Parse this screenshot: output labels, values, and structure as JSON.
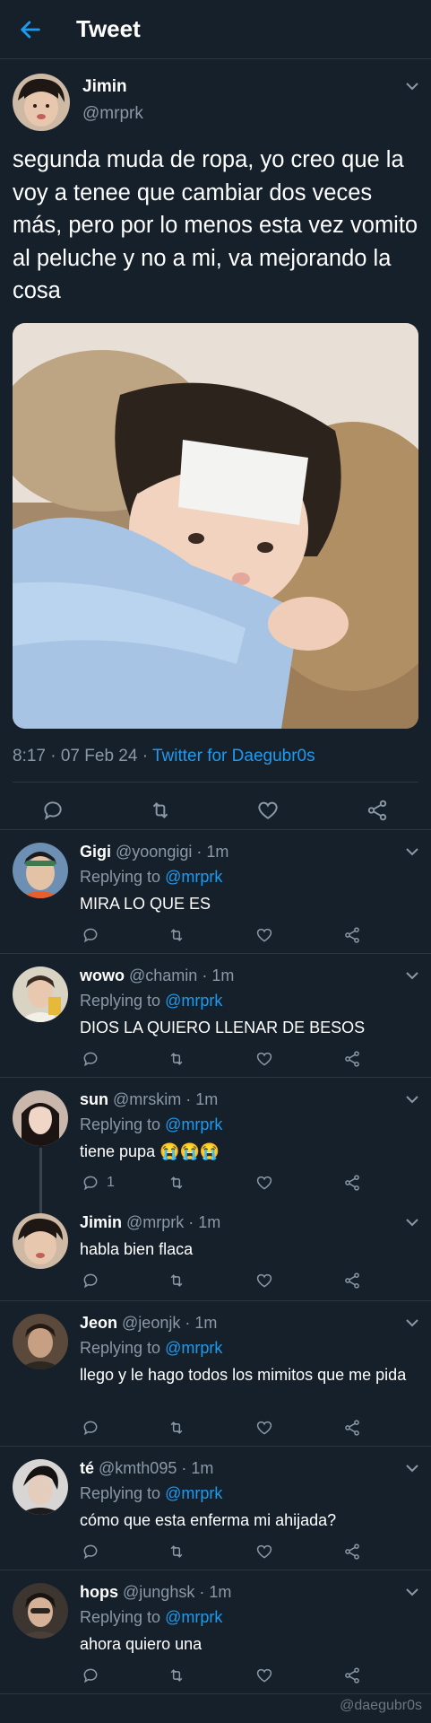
{
  "header": {
    "title": "Tweet",
    "back_icon": "arrow-left-icon"
  },
  "main_tweet": {
    "author_name": "Jimin",
    "author_handle": "@mrprk",
    "text": "segunda muda de ropa, yo creo que la voy a tenee que cambiar dos veces más, pero por lo menos esta vez vomito al peluche y no a mi, va mejorando la cosa",
    "timestamp": "8:17 · 07 Feb 24 · ",
    "source": "Twitter for Daegubr0s",
    "actions": [
      "reply-icon",
      "retweet-icon",
      "like-icon",
      "share-icon"
    ]
  },
  "replies": [
    {
      "name": "Gigi",
      "handle": "@yoongigi",
      "time": " · 1m",
      "replying_label": "Replying to ",
      "mention": "@mrprk",
      "text": "MIRA LO QUE ES",
      "reply_count": ""
    },
    {
      "name": "wowo",
      "handle": "@chamin",
      "time": " · 1m",
      "replying_label": "Replying to ",
      "mention": "@mrprk",
      "text": "DIOS LA QUIERO LLENAR DE BESOS",
      "reply_count": ""
    },
    {
      "name": "sun",
      "handle": "@mrskim",
      "time": " · 1m",
      "replying_label": "Replying to ",
      "mention": "@mrprk",
      "text": "tiene pupa 😭😭😭",
      "reply_count": "1"
    },
    {
      "name": "Jimin",
      "handle": "@mrprk",
      "time": " · 1m",
      "replying_label": "",
      "mention": "",
      "text": "habla bien flaca",
      "reply_count": ""
    },
    {
      "name": "Jeon",
      "handle": "@jeonjk",
      "time": " · 1m",
      "replying_label": "Replying to ",
      "mention": "@mrprk",
      "text": "llego y le hago todos los mimitos que me pida",
      "reply_count": ""
    },
    {
      "name": "té",
      "handle": "@kmth095",
      "time": " · 1m",
      "replying_label": "Replying to ",
      "mention": "@mrprk",
      "text": "cómo que esta enferma mi ahijada?",
      "reply_count": ""
    },
    {
      "name": "hops",
      "handle": "@junghsk",
      "time": " · 1m",
      "replying_label": "Replying to ",
      "mention": "@mrprk",
      "text": "ahora quiero una",
      "reply_count": ""
    }
  ],
  "watermark": "@daegubr0s",
  "colors": {
    "background": "#15202b",
    "accent": "#1d9bf0",
    "muted": "#8b98a5",
    "divider": "#2c3640"
  }
}
